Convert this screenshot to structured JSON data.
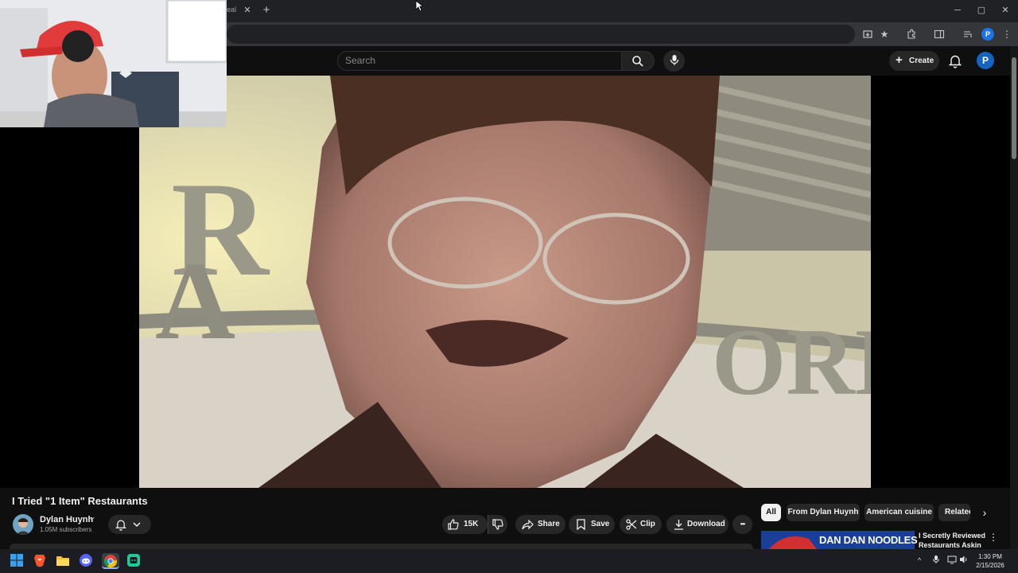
{
  "browser": {
    "tab_fragment": "eal",
    "tab_close": "✕",
    "new_tab": "+",
    "minimize": "─",
    "maximize": "▢",
    "close": "✕",
    "profile_initial": "P"
  },
  "header": {
    "search_placeholder": "Search",
    "create_label": "Create",
    "avatar_initial": "P"
  },
  "video": {
    "title": "I Tried \"1 Item\" Restaurants",
    "channel_name": "Dylan Huynh",
    "verified_mark": "✔",
    "subscribers": "1.05M subscribers",
    "like_count": "15K",
    "share_label": "Share",
    "save_label": "Save",
    "clip_label": "Clip",
    "download_label": "Download",
    "more_label": "•••"
  },
  "chips": [
    "All",
    "From Dylan Huynh",
    "American cuisine",
    "Relatec"
  ],
  "chip_next": "›",
  "recommendation": {
    "thumbnail_text": "DAN DAN NOODLES",
    "title_line1": "I Secretly Reviewed",
    "title_line2": "Restaurants Askin",
    "more": "⋮"
  },
  "taskbar": {
    "time": "1:30 PM",
    "date": "2/15/2026",
    "tray_chevron": "^"
  },
  "colors": {
    "yt_background": "#0f0f0f",
    "chrome_tabstrip": "#202124",
    "accent_profile": "#1a73e8"
  }
}
